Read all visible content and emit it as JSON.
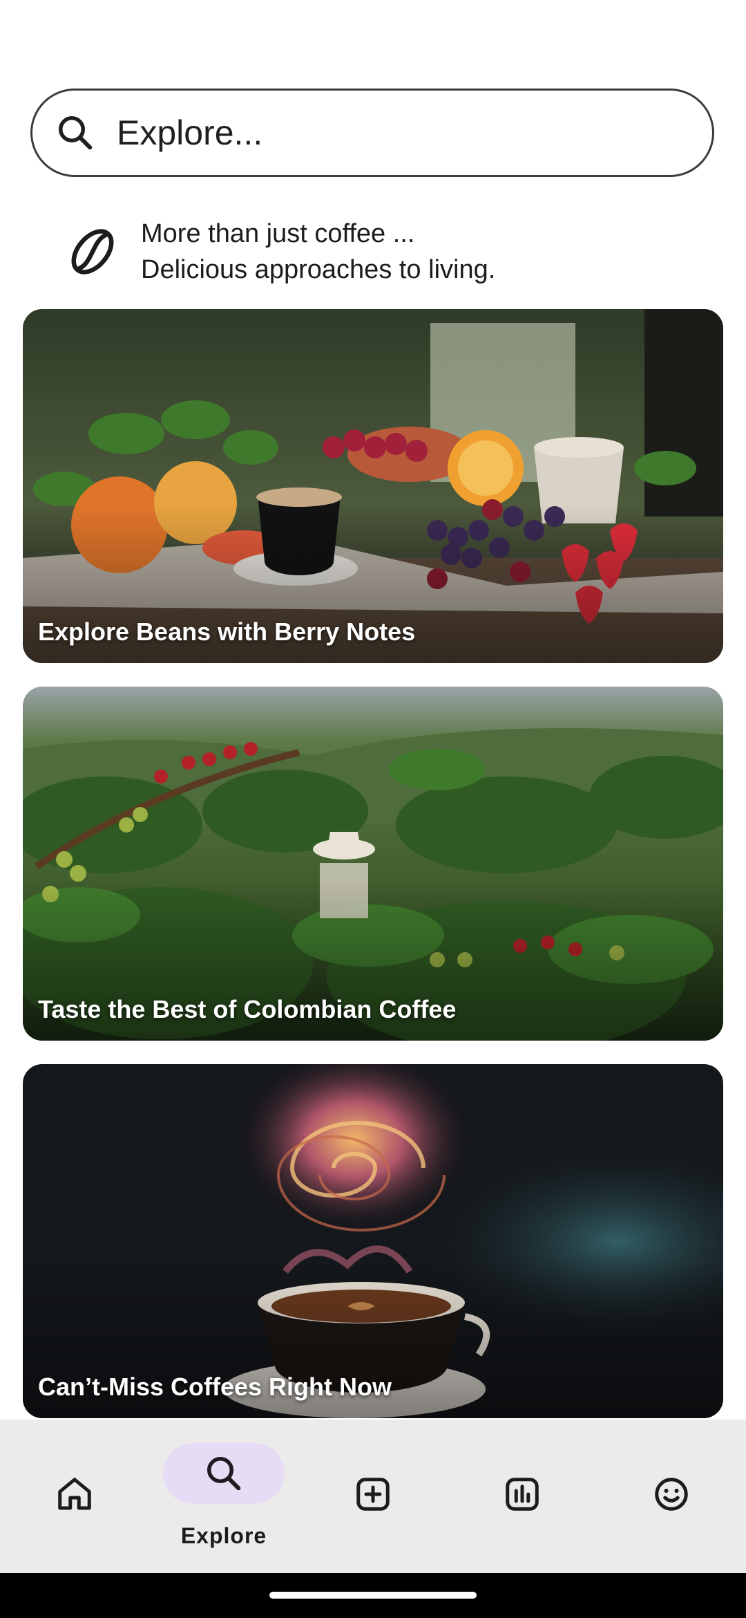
{
  "search": {
    "placeholder": "Explore..."
  },
  "tagline": {
    "line1": "More than just coffee ...",
    "line2": "Delicious approaches to living."
  },
  "cards": [
    {
      "title": "Explore Beans with Berry Notes",
      "image": "coffee-with-fruits-and-berries"
    },
    {
      "title": "Taste the Best of Colombian Coffee",
      "image": "colombian-coffee-plantation"
    },
    {
      "title": "Can’t-Miss Coffees Right Now",
      "image": "coffee-cup-with-galaxy-swirl"
    }
  ],
  "nav": {
    "items": [
      {
        "icon": "home-icon",
        "label": ""
      },
      {
        "icon": "search-icon",
        "label": "Explore",
        "active": true
      },
      {
        "icon": "add-icon",
        "label": ""
      },
      {
        "icon": "stats-icon",
        "label": ""
      },
      {
        "icon": "profile-face-icon",
        "label": ""
      }
    ]
  },
  "colors": {
    "active_pill": "#e7dcf6",
    "navbar_bg": "#ebebeb",
    "outline": "#3b3b3b"
  }
}
